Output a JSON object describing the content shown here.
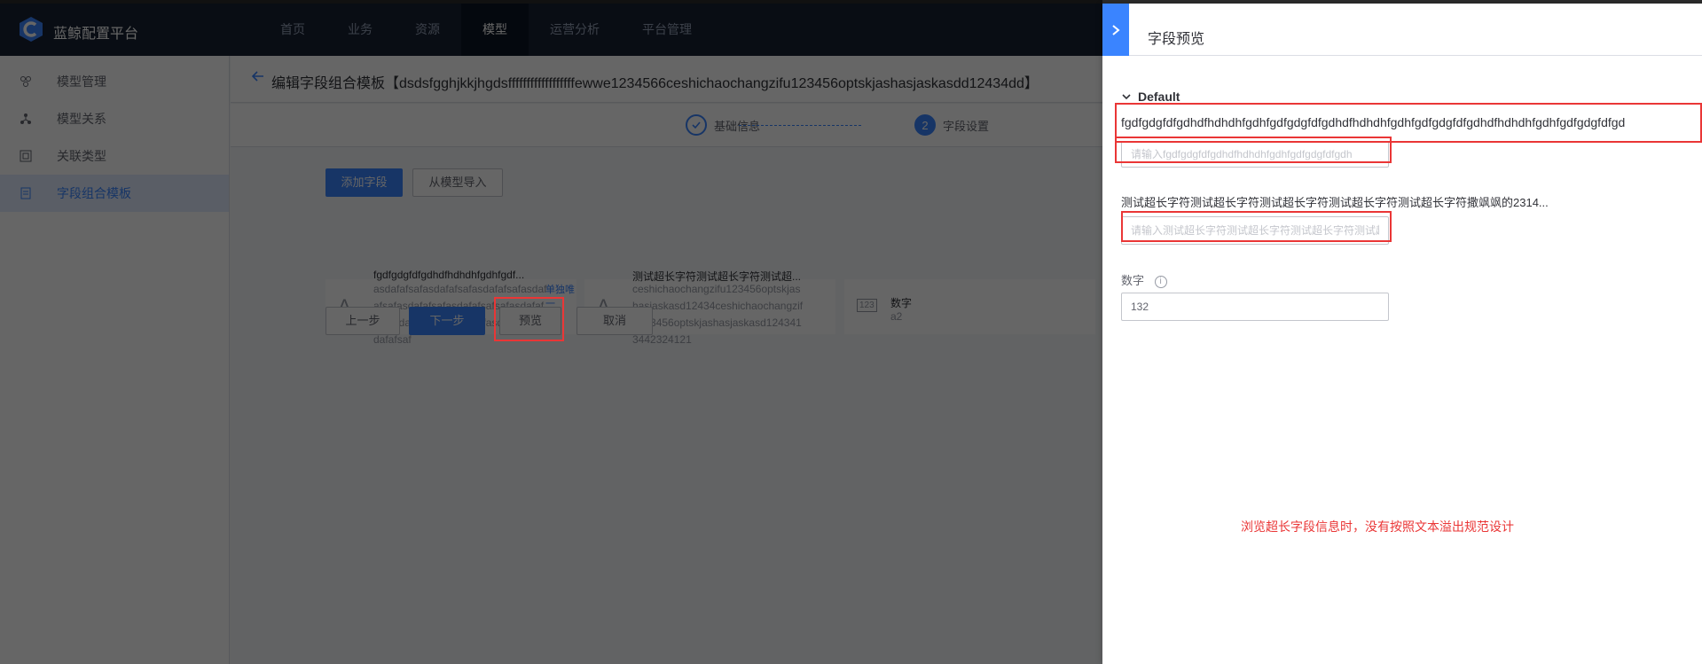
{
  "app": {
    "brand": "蓝鲸配置平台"
  },
  "nav": {
    "items": [
      "首页",
      "业务",
      "资源",
      "模型",
      "运营分析",
      "平台管理"
    ],
    "active_index": 3
  },
  "sidebar": {
    "items": [
      {
        "label": "模型管理",
        "icon": "model-cluster-icon"
      },
      {
        "label": "模型关系",
        "icon": "topology-icon"
      },
      {
        "label": "关联类型",
        "icon": "relation-type-icon"
      },
      {
        "label": "字段组合模板",
        "icon": "template-icon"
      }
    ],
    "active_index": 3
  },
  "page": {
    "title": "编辑字段组合模板【dsdsfgghjkkjhgdsffffffffffffffffffewwe1234566ceshichaochangzifu123456optskjashasjaskasdd12434dd】"
  },
  "steps": {
    "step1": "基础信息",
    "step2": "字段设置",
    "step2_num": "2"
  },
  "toolbar": {
    "add_field": "添加字段",
    "import_from_model": "从模型导入"
  },
  "fields": [
    {
      "icon": "A",
      "name": "fgdfgdgfdfgdhdfhdhdhfgdhfgdf...",
      "sub": "asdafafsafasdafafsafasdafafsafasdafafsafasdafafsafasdafafsafsafasdafafsafasdafafsafasdafafsafasdafafsafasdafafsaf",
      "tag": "单独唯一"
    },
    {
      "icon": "A",
      "name": "测试超长字符测试超长字符测试超...",
      "sub": "ceshichaochangzifu123456optskjashasjaskasd12434ceshichaochangzifu123456optskjashasjaskasd1243413442324121"
    },
    {
      "icon": "123",
      "name": "数字",
      "sub": "a2"
    }
  ],
  "actions": {
    "prev": "上一步",
    "next": "下一步",
    "preview": "预览",
    "cancel": "取消"
  },
  "drawer": {
    "title": "字段预览",
    "group": "Default",
    "field1_label": "fgdfgdgfdfgdhdfhdhdhfgdhfgdfgdgfdfgdhdfhdhdhfgdhfgdfgdgfdfgdhdfhdhdhfgdhfgdfgdgfdfgd",
    "field1_placeholder": "请输入fgdfgdgfdfgdhdfhdhdhfgdhfgdfgdgfdfgdh",
    "field2_label": "测试超长字符测试超长字符测试超长字符测试超长字符测试超长字符撒飒飒的2314...",
    "field2_placeholder": "请输入测试超长字符测试超长字符测试超长字符测试超",
    "field3_label": "数字",
    "field3_value": "132",
    "info_icon": "info-icon",
    "note": "浏览超长字段信息时，没有按照文本溢出规范设计"
  },
  "colors": {
    "primary": "#3a84ff",
    "nav_bg": "#182132",
    "annotation": "#ea3636"
  }
}
